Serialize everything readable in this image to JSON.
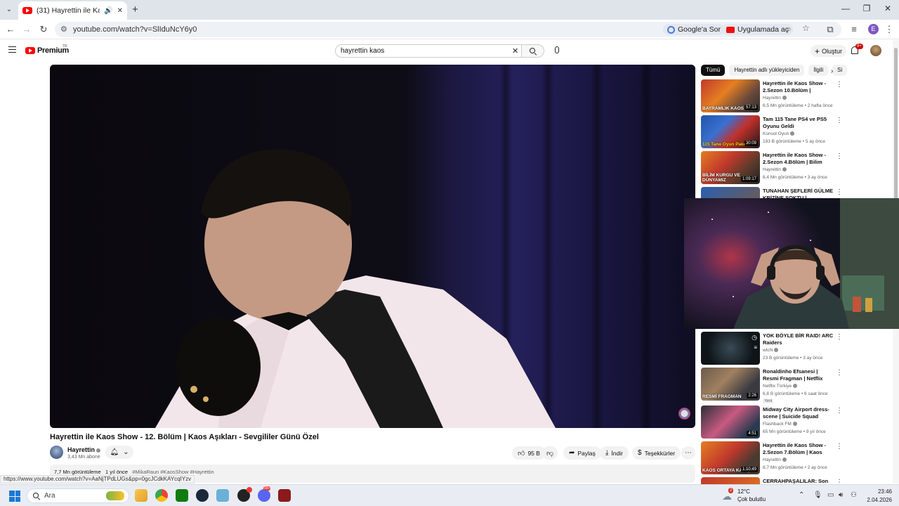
{
  "browser": {
    "tab_title": "(31) Hayrettin ile Kaos Show",
    "url": "youtube.com/watch?v=SlIduNcY6y0",
    "chip_google": "Google'a Sor",
    "chip_app": "Uygulamada aç",
    "profile_initial": "E",
    "status_url": "https://www.youtube.com/watch?v=AaNjTPdLUGs&pp=0gcJCdkKAYcqIYzv"
  },
  "youtube": {
    "logo_text": "Premium",
    "logo_region": "TR",
    "search_value": "hayrettin kaos",
    "create_label": "Oluştur",
    "notif_badge": "9+"
  },
  "video": {
    "title": "Hayrettin ile Kaos Show - 12. Bölüm | Kaos Aşıkları - Sevgililer Günü Özel",
    "channel": "Hayrettin",
    "subscribers": "3,43 Mn abone",
    "likes": "95 B",
    "share": "Paylaş",
    "download": "İndir",
    "thanks": "Teşekkürler",
    "views": "7,7 Mn görüntüleme",
    "age": "1 yıl önce",
    "tags": "#MikaRaun #KaosShow #Hayrettin"
  },
  "sidebar": {
    "filters": [
      "Tümü",
      "Hayrettin adlı yükleyiciden",
      "İlgili",
      "Si"
    ],
    "items": [
      {
        "title": "Hayrettin ile Kaos Show - 2.Sezon 10.Bölüm | Bayramlık ...",
        "channel": "Hayrettin",
        "meta": "6,5 Mn görüntüleme • 2 hafta önce",
        "duration": "57:13",
        "thumb_label": "BAYRAMLIK KAOS"
      },
      {
        "title": "Tam 115 Tane PS4 ve PS5 Oyunu Geldi",
        "channel": "Konsol Oyun",
        "meta": "193 B görüntüleme • 5 ay önce",
        "duration": "30:09",
        "thumb_label": "115 Tane Oyun Paketi"
      },
      {
        "title": "Hayrettin ile Kaos Show - 2.Sezon 4.Bölüm | Bilim Kurgu...",
        "channel": "Hayrettin",
        "meta": "8,4 Mn görüntüleme • 3 ay önce",
        "duration": "1:09:17",
        "thumb_label": "BİLİM KURGU VE DÜNYAMIZ"
      },
      {
        "title": "TUNAHAN ŞEFLERİ GÜLME KRİZİNE SOKTU | MasterChef",
        "channel": "",
        "meta": "",
        "duration": "",
        "thumb_label": ""
      },
      {
        "title": "YOK BÖYLE BİR RAID! ARC Raiders",
        "channel": "wtcN",
        "meta": "23 B görüntüleme • 3 ay önce",
        "duration": "",
        "thumb_label": ""
      },
      {
        "title": "Ronaldinho Efsanesi | Resmi Fragman | Netflix",
        "channel": "Netflix Türkiye",
        "meta": "6,8 B görüntüleme • 6 saat önce",
        "duration": "2:26",
        "thumb_label": "RESMİ FRAGMAN",
        "badge": "Yeni"
      },
      {
        "title": "Midway City Airport dress-scene | Suicide Squad",
        "channel": "Flashback FM",
        "meta": "65 Mn görüntüleme • 9 yıl önce",
        "duration": "4:51",
        "thumb_label": ""
      },
      {
        "title": "Hayrettin ile Kaos Show - 2.Sezon 7.Bölüm | Kaos Ortay...",
        "channel": "Hayrettin",
        "meta": "8,7 Mn görüntüleme • 2 ay önce",
        "duration": "1:10:49",
        "thumb_label": "KAOS ORTAYA KARIŞIK"
      },
      {
        "title": "CERRAHPAŞALILAR: Son Oyun -",
        "channel": "",
        "meta": "",
        "duration": "",
        "thumb_label": ""
      }
    ]
  },
  "taskbar": {
    "search_placeholder": "Ara",
    "temp": "12°C",
    "weather": "Çok bulutlu",
    "weather_badge": "2",
    "time": "23:46",
    "date": "2.04.2026",
    "steam_badge": "99+"
  }
}
